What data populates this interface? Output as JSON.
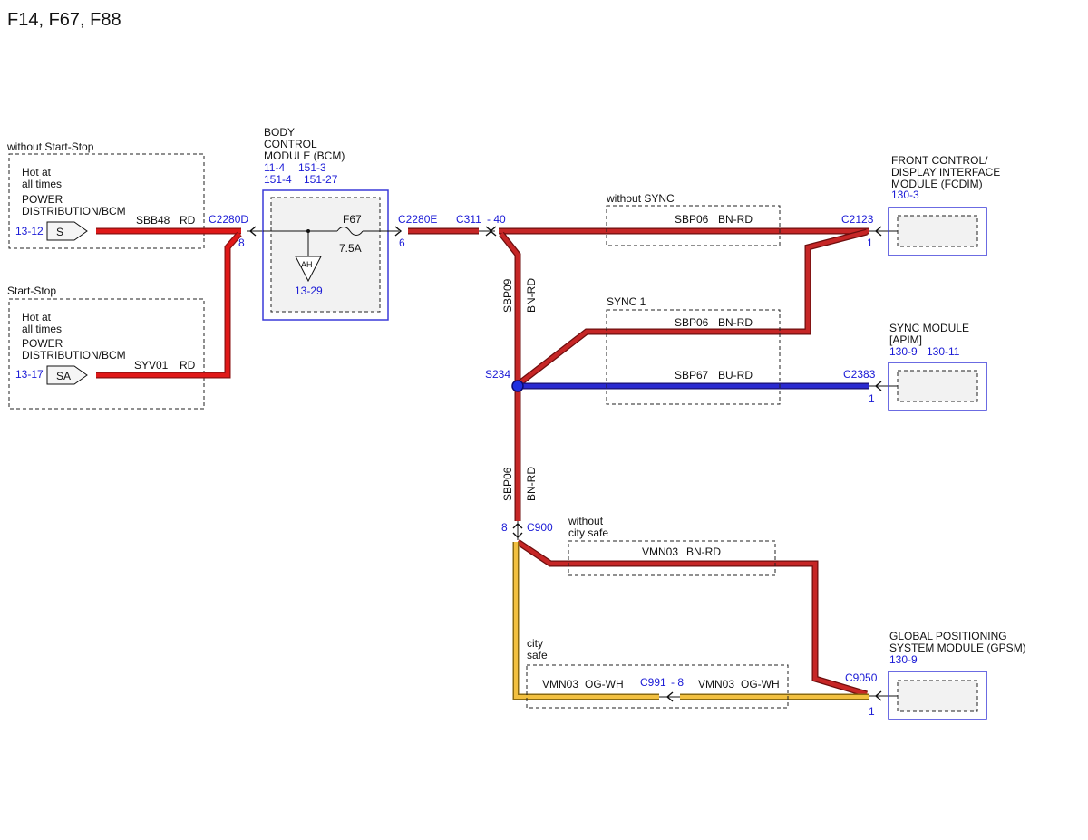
{
  "title": "F14, F67, F88",
  "colors": {
    "wire_red": "#e01818",
    "wire_brown_red": "#c62626",
    "wire_blue": "#2a2ad0",
    "wire_orange_white": "#f2c040",
    "reference_blue": "#1a1ad6",
    "module_border": "#3a3ad8"
  },
  "sources": {
    "no_start_stop": {
      "group_label": "without Start-Stop",
      "hot_label_1": "Hot at",
      "hot_label_2": "all times",
      "source_label_1": "POWER",
      "source_label_2": "DISTRIBUTION/BCM",
      "ref": "13-12",
      "pin": "S",
      "wire": "SBB48",
      "color": "RD"
    },
    "start_stop": {
      "group_label": "Start-Stop",
      "hot_label_1": "Hot at",
      "hot_label_2": "all times",
      "source_label_1": "POWER",
      "source_label_2": "DISTRIBUTION/BCM",
      "ref": "13-17",
      "pin": "SA",
      "wire": "SYV01",
      "color": "RD"
    }
  },
  "bcm": {
    "name_1": "BODY",
    "name_2": "CONTROL",
    "name_3": "MODULE (BCM)",
    "ref_1": "11-4",
    "ref_2": "151-3",
    "ref_3": "151-4",
    "ref_4": "151-27",
    "in_connector": "C2280D",
    "in_pin": "8",
    "out_connector": "C2280E",
    "out_pin": "6",
    "fuse": "F67",
    "fuse_rating": "7.5A",
    "ground_label": "AH",
    "ground_ref": "13-29"
  },
  "inline": {
    "c311": "C311",
    "c311_pin": "- 40",
    "trunk_wire": "SBP09",
    "trunk_color": "BN-RD",
    "splice": "S234",
    "lower_wire": "SBP06",
    "lower_color": "BN-RD",
    "c900_pin": "8",
    "c900": "C900"
  },
  "branches": {
    "without_sync": {
      "label": "without SYNC",
      "wire": "SBP06",
      "color": "BN-RD"
    },
    "sync1": {
      "label": "SYNC 1",
      "wire": "SBP06",
      "color": "BN-RD",
      "wire2": "SBP67",
      "color2": "BU-RD"
    },
    "without_city_safe": {
      "label_1": "without",
      "label_2": "city safe",
      "wire": "VMN03",
      "color": "BN-RD"
    },
    "city_safe": {
      "label_1": "city",
      "label_2": "safe",
      "wire_a": "VMN03",
      "color_a": "OG-WH",
      "connector": "C991",
      "connector_pin": "- 8",
      "wire_b": "VMN03",
      "color_b": "OG-WH"
    }
  },
  "modules": {
    "fcdim": {
      "name_1": "FRONT CONTROL/",
      "name_2": "DISPLAY INTERFACE",
      "name_3": "MODULE (FCDIM)",
      "ref": "130-3",
      "connector": "C2123",
      "pin": "1"
    },
    "apim": {
      "name_1": "SYNC MODULE",
      "name_2": "[APIM]",
      "ref_1": "130-9",
      "ref_2": "130-11",
      "connector": "C2383",
      "pin": "1"
    },
    "gpsm": {
      "name_1": "GLOBAL POSITIONING",
      "name_2": "SYSTEM MODULE (GPSM)",
      "ref": "130-9",
      "connector": "C9050",
      "pin": "1"
    }
  }
}
